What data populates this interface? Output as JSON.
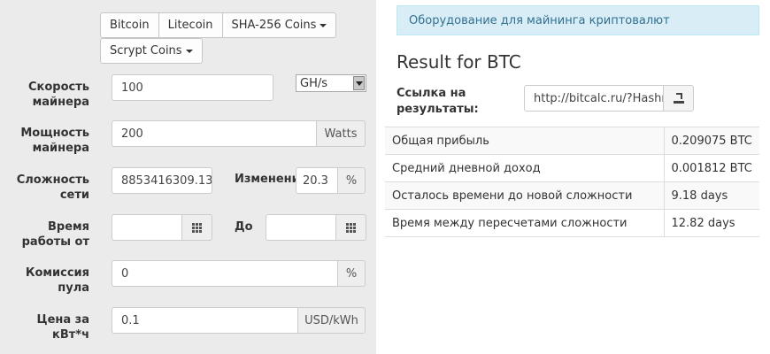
{
  "coins": {
    "bitcoin": "Bitcoin",
    "litecoin": "Litecoin",
    "sha256": "SHA-256 Coins",
    "scrypt": "Scrypt Coins"
  },
  "form": {
    "speed": {
      "label": "Скорость майнера",
      "value": "100",
      "unit": "GH/s"
    },
    "power": {
      "label": "Мощность майнера",
      "value": "200",
      "unit": "Watts"
    },
    "difficulty": {
      "label": "Сложность сети",
      "value": "8853416309.13",
      "change_label": "Изменение",
      "change_value": "20.3",
      "change_unit": "%"
    },
    "time": {
      "label": "Время работы от",
      "from_value": "",
      "to_label": "До",
      "to_value": ""
    },
    "pool_fee": {
      "label": "Комиссия пула",
      "value": "0",
      "unit": "%"
    },
    "price": {
      "label": "Цена за кВт*ч",
      "value": "0.1",
      "unit": "USD/kWh"
    }
  },
  "results": {
    "banner": "Оборудование для майнинга криптовалют",
    "title": "Result for BTC",
    "link_label": "Ссылка на результаты:",
    "link_value": "http://bitcalc.ru/?Hashrate",
    "rows": [
      {
        "label": "Общая прибыль",
        "value": "0.209075 BTC"
      },
      {
        "label": "Средний дневной доход",
        "value": "0.001812 BTC"
      },
      {
        "label": "Осталось времени до новой сложности",
        "value": "9.18 days"
      },
      {
        "label": "Время между пересчетами сложности",
        "value": "12.82 days"
      }
    ]
  }
}
